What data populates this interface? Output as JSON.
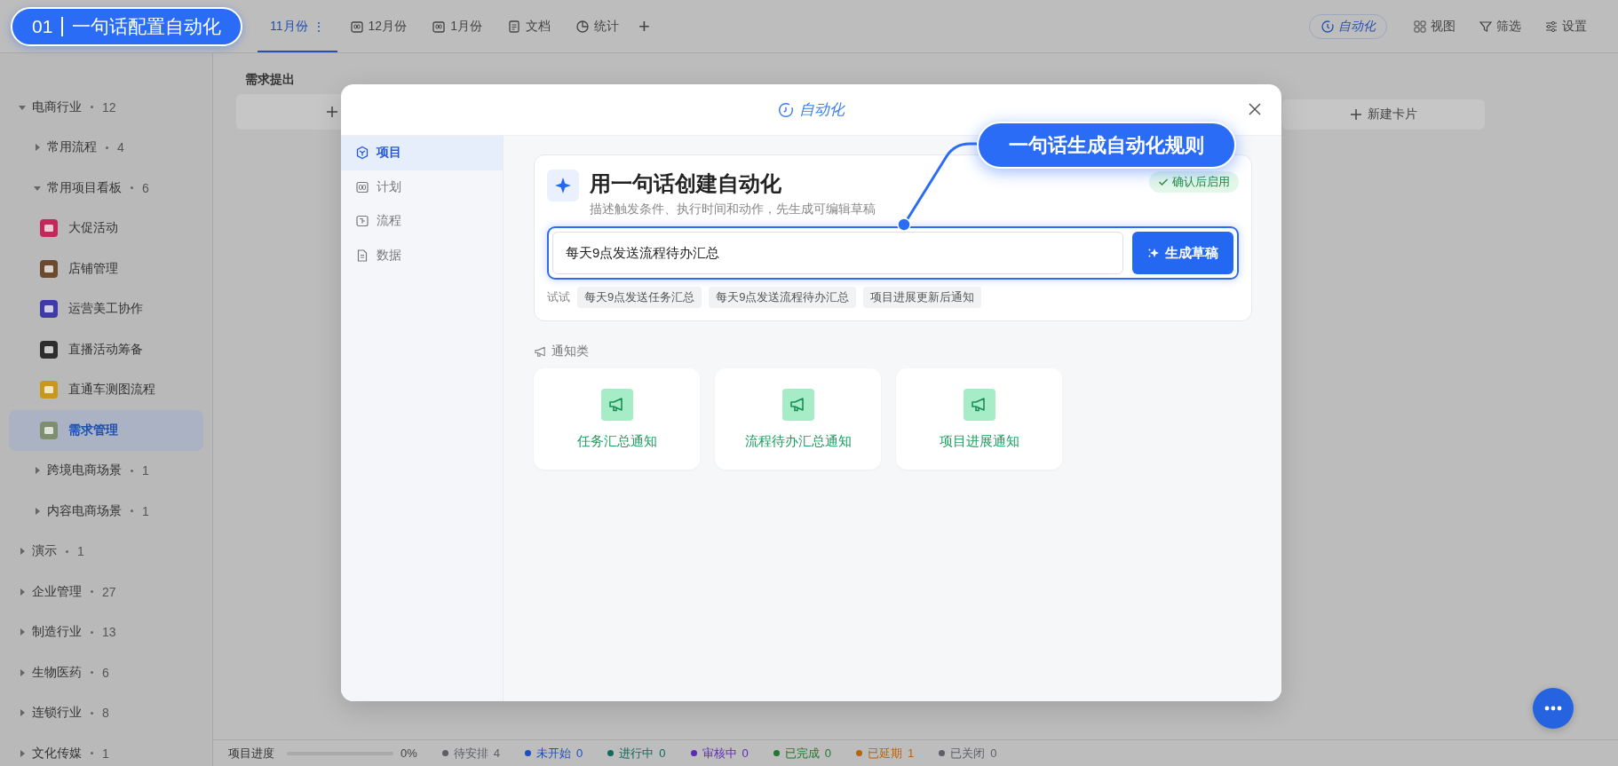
{
  "badge": {
    "step": "01",
    "title": "一句话配置自动化"
  },
  "tabs": [
    {
      "label": "11月份",
      "kind": "text",
      "selected": true,
      "menu": "⋮"
    },
    {
      "label": "12月份",
      "kind": "month",
      "selected": false
    },
    {
      "label": "1月份",
      "kind": "month",
      "selected": false
    },
    {
      "label": "文档",
      "kind": "doc",
      "selected": false
    },
    {
      "label": "统计",
      "kind": "stats",
      "selected": false
    }
  ],
  "add_tab": "+",
  "toolbar": [
    {
      "label": "自动化",
      "kind": "automation",
      "active": true
    },
    {
      "label": "视图",
      "kind": "view",
      "active": false
    },
    {
      "label": "筛选",
      "kind": "filter",
      "active": false
    },
    {
      "label": "设置",
      "kind": "settings",
      "active": false
    }
  ],
  "sidebar": {
    "items": [
      {
        "kind": "group",
        "label": "电商行业",
        "count": "12",
        "expanded": true,
        "selected": false,
        "children": [
          {
            "kind": "group",
            "label": "常用流程",
            "count": "4",
            "expanded": false,
            "selected": false
          },
          {
            "kind": "group",
            "label": "常用项目看板",
            "count": "6",
            "expanded": true,
            "selected": false,
            "children": [
              {
                "kind": "board",
                "label": "大促活动",
                "color": "#c2285a",
                "selected": false
              },
              {
                "kind": "board",
                "label": "店铺管理",
                "color": "#6b4a2e",
                "selected": false
              },
              {
                "kind": "board",
                "label": "运营美工协作",
                "color": "#3f3aa8",
                "selected": false
              },
              {
                "kind": "board",
                "label": "直播活动筹备",
                "color": "#2d2d2d",
                "selected": false
              },
              {
                "kind": "board",
                "label": "直通车测图流程",
                "color": "#c9971a",
                "selected": false
              },
              {
                "kind": "board",
                "label": "需求管理",
                "color": "#7d8f6e",
                "selected": true
              }
            ]
          },
          {
            "kind": "group",
            "label": "跨境电商场景",
            "count": "1",
            "expanded": false,
            "selected": false
          },
          {
            "kind": "group",
            "label": "内容电商场景",
            "count": "1",
            "expanded": false,
            "selected": false
          }
        ]
      },
      {
        "kind": "group",
        "label": "演示",
        "count": "1",
        "expanded": false,
        "selected": false
      },
      {
        "kind": "group",
        "label": "企业管理",
        "count": "27",
        "expanded": false,
        "selected": false
      },
      {
        "kind": "group",
        "label": "制造行业",
        "count": "13",
        "expanded": false,
        "selected": false
      },
      {
        "kind": "group",
        "label": "生物医药",
        "count": "6",
        "expanded": false,
        "selected": false
      },
      {
        "kind": "group",
        "label": "连锁行业",
        "count": "8",
        "expanded": false,
        "selected": false
      },
      {
        "kind": "group",
        "label": "文化传媒",
        "count": "1",
        "expanded": false,
        "selected": false
      }
    ]
  },
  "board": {
    "first_column": "需求提出",
    "new_card": "新建卡片"
  },
  "modal": {
    "title": "自动化",
    "nav": [
      {
        "label": "项目",
        "kind": "project",
        "selected": true
      },
      {
        "label": "计划",
        "kind": "plan",
        "selected": false
      },
      {
        "label": "流程",
        "kind": "flow",
        "selected": false
      },
      {
        "label": "数据",
        "kind": "data",
        "selected": false
      }
    ],
    "composer": {
      "title": "用一句话创建自动化",
      "subtitle": "描述触发条件、执行时间和动作，先生成可编辑草稿",
      "badge": "确认后启用",
      "value": "每天9点发送流程待办汇总",
      "focused": true,
      "button": "生成草稿",
      "try_label": "试试",
      "suggestions": [
        "每天9点发送任务汇总",
        "每天9点发送流程待办汇总",
        "项目进展更新后通知"
      ]
    },
    "section": "通知类",
    "templates": [
      {
        "label": "任务汇总通知"
      },
      {
        "label": "流程待办汇总通知"
      },
      {
        "label": "项目进展通知"
      }
    ]
  },
  "callout": "一句话生成自动化规则",
  "status_bar": {
    "progress_label": "项目进度",
    "level": 0,
    "reading": "0%",
    "statuses": [
      {
        "label": "待安排",
        "count": "4",
        "color": "#5c5f66"
      },
      {
        "label": "未开始",
        "count": "0",
        "color": "#1d4fc4"
      },
      {
        "label": "进行中",
        "count": "0",
        "color": "#0f6b5a"
      },
      {
        "label": "审核中",
        "count": "0",
        "color": "#5b2bb5"
      },
      {
        "label": "已完成",
        "count": "0",
        "color": "#1d7a2e"
      },
      {
        "label": "已延期",
        "count": "1",
        "color": "#b8630f"
      },
      {
        "label": "已关闭",
        "count": "0",
        "color": "#5c5f66"
      }
    ]
  }
}
